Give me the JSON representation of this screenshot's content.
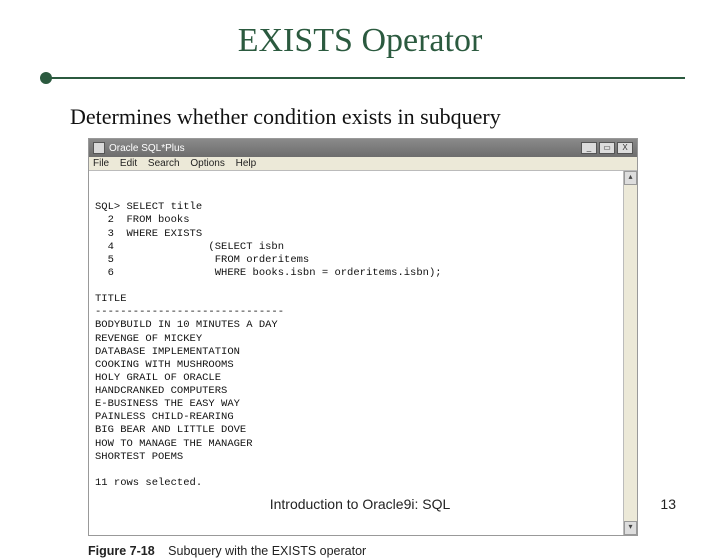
{
  "title": "EXISTS Operator",
  "subtitle": "Determines whether condition exists in subquery",
  "window": {
    "app_title": "Oracle SQL*Plus",
    "menus": {
      "file": "File",
      "edit": "Edit",
      "search": "Search",
      "options": "Options",
      "help": "Help"
    },
    "buttons": {
      "min": "_",
      "max": "▭",
      "close": "X"
    },
    "scroll": {
      "up": "▴",
      "down": "▾"
    }
  },
  "terminal": {
    "lines": [
      "SQL> SELECT title",
      "  2  FROM books",
      "  3  WHERE EXISTS",
      "  4               (SELECT isbn",
      "  5                FROM orderitems",
      "  6                WHERE books.isbn = orderitems.isbn);",
      "",
      "TITLE",
      "------------------------------",
      "BODYBUILD IN 10 MINUTES A DAY",
      "REVENGE OF MICKEY",
      "DATABASE IMPLEMENTATION",
      "COOKING WITH MUSHROOMS",
      "HOLY GRAIL OF ORACLE",
      "HANDCRANKED COMPUTERS",
      "E-BUSINESS THE EASY WAY",
      "PAINLESS CHILD-REARING",
      "BIG BEAR AND LITTLE DOVE",
      "HOW TO MANAGE THE MANAGER",
      "SHORTEST POEMS",
      "",
      "11 rows selected."
    ]
  },
  "caption": {
    "label": "Figure 7-18",
    "text": "Subquery with the EXISTS operator"
  },
  "footer": {
    "title": "Introduction to Oracle9i: SQL",
    "page": "13"
  }
}
